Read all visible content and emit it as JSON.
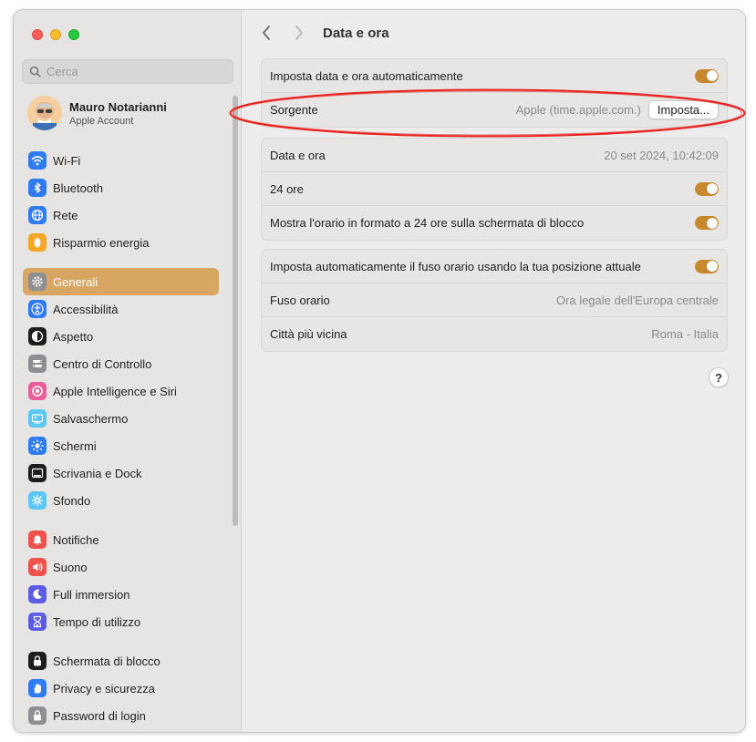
{
  "search": {
    "placeholder": "Cerca"
  },
  "account": {
    "name": "Mauro Notarianni",
    "subtitle": "Apple Account"
  },
  "sidebar": {
    "items": [
      {
        "label": "Wi-Fi",
        "icon": "wifi-icon",
        "color": "#2f7bf5"
      },
      {
        "label": "Bluetooth",
        "icon": "bluetooth-icon",
        "color": "#2f7bf5"
      },
      {
        "label": "Rete",
        "icon": "globe-icon",
        "color": "#2f7bf5"
      },
      {
        "label": "Risparmio energia",
        "icon": "battery-icon",
        "color": "#f5a623"
      },
      {
        "label": "Generali",
        "icon": "gear-icon",
        "color": "#8e8e93",
        "active": true
      },
      {
        "label": "Accessibilità",
        "icon": "accessibility-icon",
        "color": "#2f7bf5"
      },
      {
        "label": "Aspetto",
        "icon": "appearance-icon",
        "color": "#1d1d1f"
      },
      {
        "label": "Centro di Controllo",
        "icon": "control-center-icon",
        "color": "#8e8e93"
      },
      {
        "label": "Apple Intelligence e Siri",
        "icon": "siri-icon",
        "color": "#e85d9a"
      },
      {
        "label": "Salvaschermo",
        "icon": "screensaver-icon",
        "color": "#5ac8fa"
      },
      {
        "label": "Schermi",
        "icon": "sun-icon",
        "color": "#2f7bf5"
      },
      {
        "label": "Scrivania e Dock",
        "icon": "dock-icon",
        "color": "#1d1d1f"
      },
      {
        "label": "Sfondo",
        "icon": "wallpaper-icon",
        "color": "#5ac8fa"
      },
      {
        "label": "Notifiche",
        "icon": "bell-icon",
        "color": "#f2504a"
      },
      {
        "label": "Suono",
        "icon": "speaker-icon",
        "color": "#f2504a"
      },
      {
        "label": "Full immersion",
        "icon": "moon-icon",
        "color": "#5e5ce6"
      },
      {
        "label": "Tempo di utilizzo",
        "icon": "hourglass-icon",
        "color": "#5e5ce6"
      },
      {
        "label": "Schermata di blocco",
        "icon": "lock-icon",
        "color": "#1d1d1f"
      },
      {
        "label": "Privacy e sicurezza",
        "icon": "hand-icon",
        "color": "#2f7bf5"
      },
      {
        "label": "Password di login",
        "icon": "password-lock-icon",
        "color": "#8e8e93"
      }
    ]
  },
  "header": {
    "title": "Data e ora"
  },
  "main": {
    "group1": {
      "auto_label": "Imposta data e ora automaticamente",
      "source_label": "Sorgente",
      "source_value": "Apple (time.apple.com.)",
      "source_button": "Imposta..."
    },
    "group2": {
      "datetime_label": "Data e ora",
      "datetime_value": "20 set 2024, 10:42:09",
      "h24_label": "24 ore",
      "lockscreen_label": "Mostra l'orario in formato a 24 ore sulla schermata di blocco"
    },
    "group3": {
      "auto_tz_label": "Imposta automaticamente il fuso orario usando la tua posizione attuale",
      "tz_label": "Fuso orario",
      "tz_value": "Ora legale dell'Europa centrale",
      "city_label": "Città più vicina",
      "city_value": "Roma - Italia"
    },
    "help": "?"
  },
  "colors": {
    "accent": "#d7a663",
    "toggle": "#c8882e",
    "annotation": "#e8231f"
  }
}
